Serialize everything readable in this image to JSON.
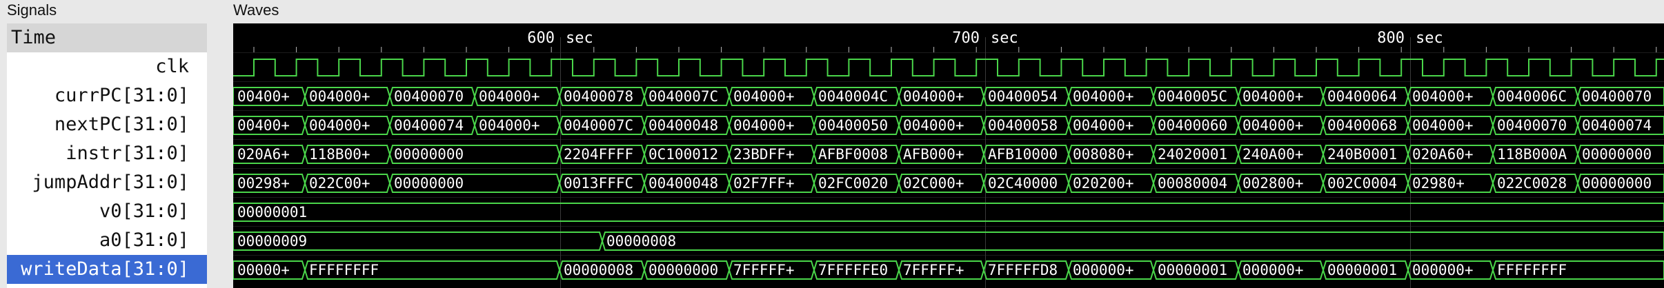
{
  "panels": {
    "signals_title": "Signals",
    "waves_title": "Waves"
  },
  "time_header": "Time",
  "time_markers": [
    {
      "value": "600",
      "unit": "sec"
    },
    {
      "value": "700",
      "unit": "sec"
    },
    {
      "value": "800",
      "unit": "sec"
    }
  ],
  "colors": {
    "wave": "#4ad64a",
    "background": "#000000",
    "text": "#ffffff",
    "selected": "#3a6ad4"
  },
  "signals": [
    {
      "name": "clk",
      "type": "clock"
    },
    {
      "name": "currPC[31:0]",
      "type": "bus",
      "values": [
        "00400+",
        "004000+",
        "00400070",
        "004000+",
        "00400078",
        "0040007C",
        "004000+",
        "0040004C",
        "004000+",
        "00400054",
        "004000+",
        "0040005C",
        "004000+",
        "00400064",
        "004000+",
        "0040006C",
        "00400070"
      ]
    },
    {
      "name": "nextPC[31:0]",
      "type": "bus",
      "values": [
        "00400+",
        "004000+",
        "00400074",
        "004000+",
        "0040007C",
        "00400048",
        "004000+",
        "00400050",
        "004000+",
        "00400058",
        "004000+",
        "00400060",
        "004000+",
        "00400068",
        "004000+",
        "00400070",
        "00400074"
      ]
    },
    {
      "name": "instr[31:0]",
      "type": "bus",
      "values": [
        "020A6+",
        "118B00+",
        "00000000",
        "2204FFFF",
        "0C100012",
        "23BDFF+",
        "AFBF0008",
        "AFB000+",
        "AFB10000",
        "008080+",
        "24020001",
        "240A00+",
        "240B0001",
        "020A60+",
        "118B000A",
        "00000000"
      ]
    },
    {
      "name": "jumpAddr[31:0]",
      "type": "bus",
      "values": [
        "00298+",
        "022C00+",
        "00000000",
        "0013FFFC",
        "00400048",
        "02F7FF+",
        "02FC0020",
        "02C000+",
        "02C40000",
        "020200+",
        "00080004",
        "002800+",
        "002C0004",
        "02980+",
        "022C0028",
        "00000000"
      ]
    },
    {
      "name": "v0[31:0]",
      "type": "bus",
      "values": [
        "00000001"
      ]
    },
    {
      "name": "a0[31:0]",
      "type": "bus",
      "values": [
        "00000009",
        "00000008"
      ]
    },
    {
      "name": "writeData[31:0]",
      "type": "bus",
      "selected": true,
      "values": [
        "00000+",
        "FFFFFFFF",
        "00000008",
        "00000000",
        "7FFFFF+",
        "7FFFFFE0",
        "7FFFFF+",
        "7FFFFFD8",
        "000000+",
        "00000001",
        "000000+",
        "00000001",
        "000000+",
        "FFFFFFFF"
      ]
    }
  ]
}
